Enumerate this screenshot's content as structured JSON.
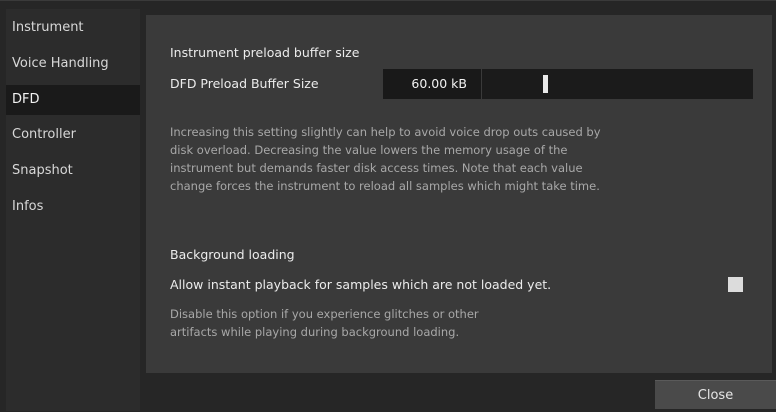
{
  "sidebar": {
    "items": [
      {
        "label": "Instrument"
      },
      {
        "label": "Voice Handling"
      },
      {
        "label": "DFD",
        "active": true
      },
      {
        "label": "Controller"
      },
      {
        "label": "Snapshot"
      },
      {
        "label": "Infos"
      }
    ]
  },
  "dfd": {
    "section_title": "Instrument preload buffer size",
    "buffer_label": "DFD Preload Buffer Size",
    "buffer_value": "60.00 kB",
    "slider_position": 0.23,
    "description_lines": [
      "Increasing this setting slightly can help to avoid voice drop outs caused by",
      "disk overload. Decreasing the value lowers the memory usage of the",
      "instrument but demands faster disk access times. Note that each value",
      "change forces the instrument to reload all samples which might take time."
    ]
  },
  "background_loading": {
    "section_title": "Background loading",
    "option_label": "Allow instant playback for samples which are not loaded yet.",
    "checked": false,
    "note_lines": [
      "Disable this option if you experience glitches or other",
      "artifacts while playing during background loading."
    ]
  },
  "footer": {
    "close_label": "Close"
  },
  "colors": {
    "background": "#262626",
    "panel": "#3a3a3a",
    "field": "#191919",
    "text": "#ececec",
    "muted_text": "#a8a8a8"
  }
}
